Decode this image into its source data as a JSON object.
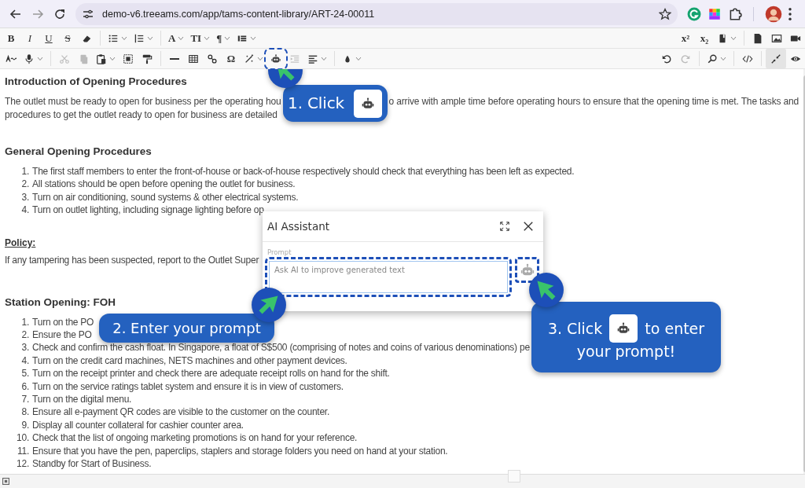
{
  "browser": {
    "url": "demo-v6.treeams.com/app/tams-content-library/ART-24-00011"
  },
  "toolbar": {
    "rows": [
      {
        "left": [
          {
            "kind": "bold",
            "text": "B",
            "dropdown": false,
            "disabled": false,
            "selected": false,
            "highlighted": false
          },
          {
            "kind": "italic",
            "text": "I",
            "dropdown": false,
            "disabled": false,
            "selected": false,
            "highlighted": false
          },
          {
            "kind": "underline",
            "text": "U",
            "dropdown": false,
            "disabled": false,
            "selected": false,
            "highlighted": false
          },
          {
            "kind": "strike",
            "text": "S",
            "dropdown": false,
            "disabled": false,
            "selected": false,
            "highlighted": false
          },
          {
            "kind": "icon",
            "dropdown": false,
            "disabled": false,
            "selected": false,
            "highlighted": false
          },
          {
            "kind": "separator"
          },
          {
            "kind": "icon",
            "dropdown": true,
            "disabled": false,
            "selected": false,
            "highlighted": false
          },
          {
            "kind": "icon",
            "dropdown": true,
            "disabled": false,
            "selected": false,
            "highlighted": false
          },
          {
            "kind": "separator"
          },
          {
            "kind": "glyph",
            "text": "A",
            "dropdown": true,
            "disabled": false,
            "selected": false,
            "highlighted": false
          },
          {
            "kind": "glyph",
            "text": "TI",
            "dropdown": true,
            "disabled": false,
            "selected": false,
            "highlighted": false
          },
          {
            "kind": "glyph",
            "text": "¶",
            "dropdown": true,
            "disabled": false,
            "selected": false,
            "highlighted": false
          },
          {
            "kind": "icon",
            "dropdown": true,
            "disabled": false,
            "selected": false,
            "highlighted": false
          }
        ],
        "right": [
          {
            "kind": "glyph",
            "text": "x²",
            "dropdown": false,
            "disabled": false,
            "selected": false,
            "highlighted": false
          },
          {
            "kind": "glyph",
            "text": "x₂",
            "dropdown": false,
            "disabled": false,
            "selected": false,
            "highlighted": false
          },
          {
            "kind": "icon",
            "dropdown": true,
            "disabled": false,
            "selected": false,
            "highlighted": false
          },
          {
            "kind": "separator"
          },
          {
            "kind": "icon",
            "dropdown": false,
            "disabled": false,
            "selected": false,
            "highlighted": false
          },
          {
            "kind": "icon",
            "dropdown": false,
            "disabled": false,
            "selected": false,
            "highlighted": false
          },
          {
            "kind": "icon",
            "dropdown": false,
            "disabled": false,
            "selected": false,
            "highlighted": false
          }
        ]
      },
      {
        "left": [
          {
            "kind": "icon",
            "dropdown": false,
            "disabled": false,
            "selected": false,
            "highlighted": false
          },
          {
            "kind": "icon",
            "dropdown": true,
            "disabled": false,
            "selected": false,
            "highlighted": false
          },
          {
            "kind": "separator"
          },
          {
            "kind": "icon",
            "dropdown": false,
            "disabled": true,
            "selected": false,
            "highlighted": false
          },
          {
            "kind": "icon",
            "dropdown": false,
            "disabled": true,
            "selected": false,
            "highlighted": false
          },
          {
            "kind": "icon",
            "dropdown": true,
            "disabled": false,
            "selected": false,
            "highlighted": false
          },
          {
            "kind": "icon",
            "dropdown": false,
            "disabled": false,
            "selected": false,
            "highlighted": false
          },
          {
            "kind": "icon",
            "dropdown": false,
            "disabled": false,
            "selected": false,
            "highlighted": false
          },
          {
            "kind": "separator"
          },
          {
            "kind": "icon",
            "dropdown": false,
            "disabled": false,
            "selected": false,
            "highlighted": false
          },
          {
            "kind": "icon",
            "dropdown": false,
            "disabled": false,
            "selected": false,
            "highlighted": false
          },
          {
            "kind": "icon",
            "dropdown": false,
            "disabled": false,
            "selected": false,
            "highlighted": false
          },
          {
            "kind": "glyph",
            "text": "Ω",
            "dropdown": false,
            "disabled": false,
            "selected": false,
            "highlighted": false
          },
          {
            "kind": "icon",
            "dropdown": true,
            "disabled": false,
            "selected": false,
            "highlighted": false
          },
          {
            "kind": "icon",
            "dropdown": false,
            "disabled": false,
            "selected": false,
            "highlighted": true
          },
          {
            "kind": "icon",
            "dropdown": false,
            "disabled": true,
            "selected": false,
            "highlighted": false
          },
          {
            "kind": "icon",
            "dropdown": true,
            "disabled": false,
            "selected": false,
            "highlighted": false
          },
          {
            "kind": "separator"
          },
          {
            "kind": "icon",
            "dropdown": true,
            "disabled": false,
            "selected": false,
            "highlighted": false
          }
        ],
        "right": [
          {
            "kind": "icon",
            "dropdown": false,
            "disabled": false,
            "selected": false,
            "highlighted": false
          },
          {
            "kind": "icon",
            "dropdown": false,
            "disabled": true,
            "selected": false,
            "highlighted": false
          },
          {
            "kind": "separator"
          },
          {
            "kind": "icon",
            "dropdown": true,
            "disabled": false,
            "selected": false,
            "highlighted": false
          },
          {
            "kind": "separator"
          },
          {
            "kind": "icon",
            "dropdown": false,
            "disabled": false,
            "selected": false,
            "highlighted": false
          },
          {
            "kind": "separator"
          },
          {
            "kind": "icon",
            "dropdown": false,
            "disabled": false,
            "selected": true,
            "highlighted": false
          },
          {
            "kind": "icon",
            "dropdown": false,
            "disabled": false,
            "selected": false,
            "highlighted": false
          }
        ]
      }
    ]
  },
  "document": {
    "intro_heading": "Introduction of Opening Procedures",
    "intro_line_1_start": "The outlet must be ready to open for business per the operating hou",
    "intro_line_1_end": "o arrive with ample time before operating hours to ensure that the opening time is met. The tasks and",
    "intro_line_2": "procedures to get the outlet ready to open for business are detailed",
    "general_heading": "General Opening Procedures",
    "general_list": [
      {
        "number": "1.",
        "text": "The first staff members to enter the front-of-house or back-of-house respectively should check that everything has been left as expected."
      },
      {
        "number": "2.",
        "text": "All stations should be open before opening the outlet for business."
      },
      {
        "number": "3.",
        "text": "Turn on air conditioning, sound systems & other electrical systems."
      },
      {
        "number": "4.",
        "text": "Turn on outlet lighting, including signage lighting before op"
      }
    ],
    "policy_label": "Policy:",
    "policy_text": "If any tampering has been suspected, report to the Outlet Super",
    "foh_heading": "Station Opening: FOH",
    "foh_list": [
      {
        "number": "1.",
        "text": "Turn on the PO"
      },
      {
        "number": "2.",
        "text": "Ensure the PO"
      },
      {
        "number": "3.",
        "text": "Check and confirm the cash float. In Singapore, a float of S$500 (comprising of notes and coins of various denominations) pe"
      },
      {
        "number": "4.",
        "text": "Turn on the credit card machines, NETS machines and other payment devices."
      },
      {
        "number": "5.",
        "text": "Turn on the receipt printer and check there are adequate receipt rolls on hand for the shift."
      },
      {
        "number": "6.",
        "text": "Turn on the service ratings tablet system and ensure it is in view of customers."
      },
      {
        "number": "7.",
        "text": "Turn on the digital menu."
      },
      {
        "number": "8.",
        "text": "Ensure all e-payment QR codes are visible to the customer on the counter."
      },
      {
        "number": "9.",
        "text": "Display all counter collateral for cashier counter area."
      },
      {
        "number": "10.",
        "text": "Check that the list of ongoing marketing promotions is on hand for your reference."
      },
      {
        "number": "11.",
        "text": "Ensure that you have the pen, paperclips, staplers and storage folders you need on hand at your station."
      },
      {
        "number": "12.",
        "text": "Standby for Start of Business."
      }
    ]
  },
  "dialog": {
    "title": "AI Assistant",
    "field_label": "Prompt",
    "placeholder": "Ask AI to improve generated text"
  },
  "callouts": [
    {
      "text": "1. Click"
    },
    {
      "text": "2. Enter your prompt"
    },
    {
      "text": "3. Click",
      "text_after": "to enter",
      "line_2": "your prompt!"
    }
  ]
}
